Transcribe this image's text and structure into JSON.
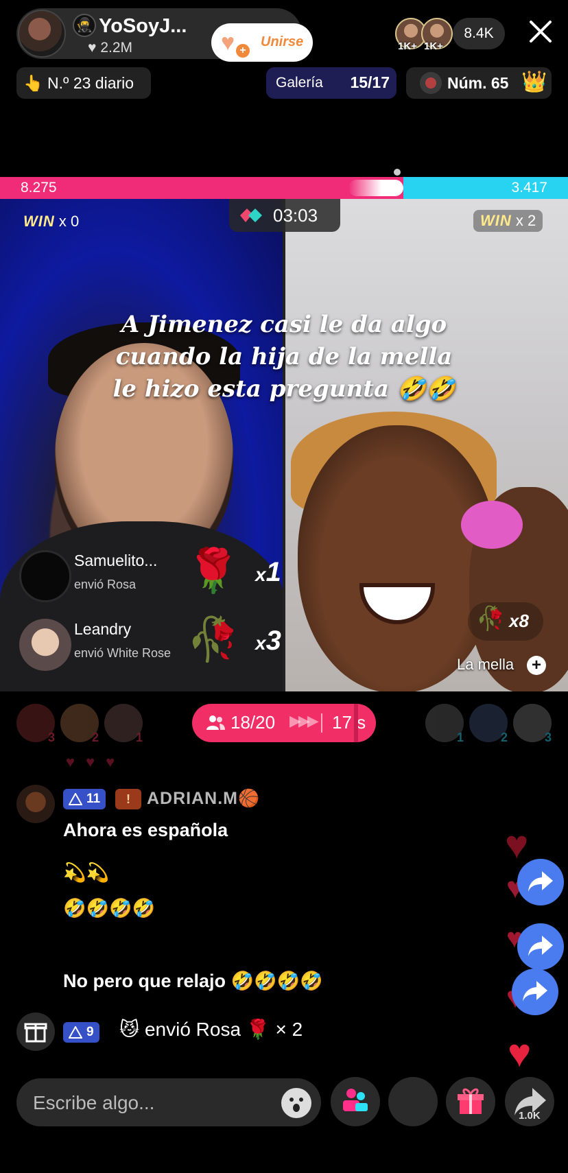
{
  "header": {
    "host_name": "YoSoyJ...",
    "host_likes": "2.2M",
    "join_label": "Unirse",
    "viewer_badges": [
      "1K+",
      "1K+"
    ],
    "viewer_count": "8.4K"
  },
  "ranks": {
    "daily": "N.º 23 diario",
    "gallery_label": "Galería",
    "gallery_count": "15/17",
    "num_label": "Núm. 65"
  },
  "battle": {
    "left_score": "8.275",
    "right_score": "3.417",
    "timer": "03:03",
    "left_win_word": "WIN",
    "left_win_count": "x 0",
    "right_win_word": "WIN",
    "right_win_count": "x 2",
    "left_share": 0.71
  },
  "caption": "A Jimenez casi le da algo\ncuando la hija de la mella\nle hizo esta pregunta 🤣🤣",
  "gifts": [
    {
      "name": "Samuelito...",
      "action": "envió Rosa",
      "emoji": "🌹",
      "count": "1"
    },
    {
      "name": "Leandry",
      "action": "envió White Rose",
      "emoji": "🥀",
      "count": "3"
    }
  ],
  "opponent": {
    "rose_emoji": "🥀",
    "rose_count": "x8",
    "name": "La mella"
  },
  "ranking_strip": {
    "left_ranks": [
      "3",
      "2",
      "1"
    ],
    "right_ranks": [
      "1",
      "2",
      "3"
    ],
    "participants": "18/20",
    "seconds": "17 s"
  },
  "chat": {
    "user": "ADRIAN.M🏀",
    "user_level": "11",
    "fan_level": "!",
    "messages": [
      "Ahora es española",
      "💫💫",
      "🤣🤣🤣🤣",
      "No pero que relajo 🤣🤣🤣🤣"
    ],
    "gift_level": "9",
    "gift_text": "😼 envió Rosa 🌹 × 2"
  },
  "bottom": {
    "placeholder": "Escribe algo...",
    "share_count": "1.0K"
  },
  "colors": {
    "battle_pink": "#f02c78",
    "battle_cyan": "#27d3f0",
    "match_pill": "#f22e67",
    "level_badge": "#3650c8"
  }
}
